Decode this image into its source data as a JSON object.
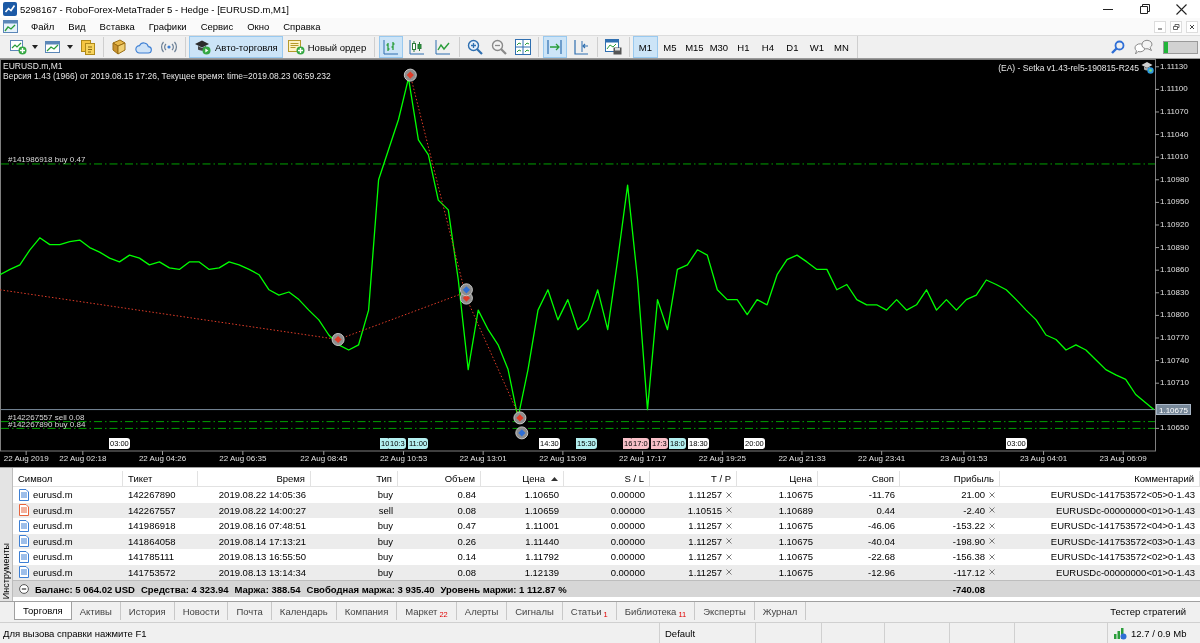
{
  "window": {
    "title": "5298167 - RoboForex-MetaTrader 5 - Hedge - [EURUSD.m,M1]"
  },
  "menu": {
    "items": [
      "Файл",
      "Вид",
      "Вставка",
      "Графики",
      "Сервис",
      "Окно",
      "Справка"
    ]
  },
  "toolbar": {
    "auto_trading": {
      "label": "Авто-торговля",
      "pressed": true
    },
    "new_order": {
      "label": "Новый ордер"
    },
    "chart_types": [
      {
        "selected": true
      },
      {
        "selected": false
      },
      {
        "selected": false
      }
    ],
    "autoscroll": {
      "on": true
    },
    "chart_shift": {
      "on": false
    },
    "timeframes": [
      {
        "label": "M1",
        "selected": true
      },
      {
        "label": "M5",
        "selected": false
      },
      {
        "label": "M15",
        "selected": false
      },
      {
        "label": "M30",
        "selected": false
      },
      {
        "label": "H1",
        "selected": false
      },
      {
        "label": "H4",
        "selected": false
      },
      {
        "label": "D1",
        "selected": false
      },
      {
        "label": "W1",
        "selected": false
      },
      {
        "label": "MN",
        "selected": false
      }
    ]
  },
  "chart": {
    "symbol": "EURUSD.m,M1",
    "info": "Версия 1.43 (1966) от 2019.08.15 17:26, Текущее время: time=2019.08.23 06:59.232",
    "expert": "(EA) - Setka v1.43-rel5-190815-R245",
    "chart_data": [
      {
        "type": "line",
        "x": [
          "2019-08-22T00:05",
          "2019-08-22T00:21",
          "2019-08-22T00:37",
          "2019-08-22T00:53",
          "2019-08-22T01:09",
          "2019-08-22T01:25",
          "2019-08-22T01:41",
          "2019-08-22T01:57",
          "2019-08-22T02:13",
          "2019-08-22T02:29",
          "2019-08-22T02:45",
          "2019-08-22T03:01",
          "2019-08-22T03:17",
          "2019-08-22T03:33",
          "2019-08-22T03:49",
          "2019-08-22T04:05",
          "2019-08-22T04:21",
          "2019-08-22T04:37",
          "2019-08-22T04:53",
          "2019-08-22T05:09",
          "2019-08-22T05:25",
          "2019-08-22T05:41",
          "2019-08-22T05:57",
          "2019-08-22T06:13",
          "2019-08-22T06:29",
          "2019-08-22T06:45",
          "2019-08-22T07:01",
          "2019-08-22T07:17",
          "2019-08-22T07:33",
          "2019-08-22T07:49",
          "2019-08-22T08:05",
          "2019-08-22T08:21",
          "2019-08-22T08:37",
          "2019-08-22T08:53",
          "2019-08-22T09:09",
          "2019-08-22T09:25",
          "2019-08-22T09:41",
          "2019-08-22T09:57",
          "2019-08-22T10:13",
          "2019-08-22T10:29",
          "2019-08-22T10:45",
          "2019-08-22T11:01",
          "2019-08-22T11:17",
          "2019-08-22T11:33",
          "2019-08-22T11:49",
          "2019-08-22T12:05",
          "2019-08-22T12:21",
          "2019-08-22T12:37",
          "2019-08-22T12:53",
          "2019-08-22T13:09",
          "2019-08-22T13:25",
          "2019-08-22T13:41",
          "2019-08-22T13:57",
          "2019-08-22T14:13",
          "2019-08-22T14:29",
          "2019-08-22T14:45",
          "2019-08-22T15:01",
          "2019-08-22T15:17",
          "2019-08-22T15:33",
          "2019-08-22T15:49",
          "2019-08-22T16:05",
          "2019-08-22T16:21",
          "2019-08-22T16:37",
          "2019-08-22T16:53",
          "2019-08-22T17:09",
          "2019-08-22T17:25",
          "2019-08-22T17:41",
          "2019-08-22T17:57",
          "2019-08-22T18:13",
          "2019-08-22T18:29",
          "2019-08-22T18:45",
          "2019-08-22T19:01",
          "2019-08-22T19:17",
          "2019-08-22T19:33",
          "2019-08-22T19:49",
          "2019-08-22T20:05",
          "2019-08-22T20:21",
          "2019-08-22T20:37",
          "2019-08-22T20:53",
          "2019-08-22T21:09",
          "2019-08-22T21:25",
          "2019-08-22T21:41",
          "2019-08-22T21:57",
          "2019-08-22T22:13",
          "2019-08-22T22:29",
          "2019-08-22T22:45",
          "2019-08-22T23:01",
          "2019-08-22T23:17",
          "2019-08-22T23:33",
          "2019-08-22T23:49",
          "2019-08-23T00:05",
          "2019-08-23T00:21",
          "2019-08-23T00:37",
          "2019-08-23T00:53",
          "2019-08-23T01:09",
          "2019-08-23T01:25",
          "2019-08-23T01:41",
          "2019-08-23T01:57",
          "2019-08-23T02:13",
          "2019-08-23T02:29",
          "2019-08-23T02:45",
          "2019-08-23T03:01",
          "2019-08-23T03:17",
          "2019-08-23T03:33",
          "2019-08-23T03:49",
          "2019-08-23T04:05",
          "2019-08-23T04:21",
          "2019-08-23T04:37",
          "2019-08-23T04:53",
          "2019-08-23T05:09",
          "2019-08-23T05:25",
          "2019-08-23T05:41",
          "2019-08-23T05:57",
          "2019-08-23T06:13",
          "2019-08-23T06:29",
          "2019-08-23T06:58"
        ],
        "series": [
          {
            "color": "#00ff00",
            "values": [
              1.10854,
              1.10861,
              1.10867,
              1.10887,
              1.10903,
              1.10894,
              1.10894,
              1.10898,
              1.109,
              1.1089,
              1.10884,
              1.10876,
              1.10871,
              1.1088,
              1.10876,
              1.10867,
              1.10871,
              1.10863,
              1.10861,
              1.10871,
              1.10871,
              1.10861,
              1.10863,
              1.10871,
              1.10867,
              1.10861,
              1.10854,
              1.10834,
              1.10827,
              1.10831,
              1.10821,
              1.10807,
              1.10794,
              1.10774,
              1.10761,
              1.10754,
              1.10761,
              1.10807,
              1.1098,
              1.1102,
              1.1106,
              1.11115,
              1.11033,
              1.11013,
              1.10953,
              1.1094,
              1.10847,
              1.10728,
              1.10807,
              1.10781,
              1.10761,
              1.10728,
              1.10664,
              1.10728,
              1.10807,
              1.10834,
              1.10794,
              1.10821,
              1.10781,
              1.10794,
              1.10834,
              1.10781,
              1.10874,
              1.10973,
              1.10847,
              1.10675,
              1.10821,
              1.10781,
              1.10861,
              1.10867,
              1.10887,
              1.1088,
              1.10834,
              1.10821,
              1.10821,
              1.10801,
              1.10821,
              1.10814,
              1.10854,
              1.10874,
              1.1088,
              1.10871,
              1.10861,
              1.10861,
              1.10834,
              1.10841,
              1.10821,
              1.10814,
              1.10814,
              1.10807,
              1.10821,
              1.10807,
              1.10814,
              1.10834,
              1.10807,
              1.10821,
              1.10807,
              1.10821,
              1.10827,
              1.10847,
              1.10841,
              1.10834,
              1.10821,
              1.10807,
              1.10794,
              1.10774,
              1.10768,
              1.10754,
              1.10761,
              1.10754,
              1.10741,
              1.10728,
              1.10721,
              1.10715,
              1.10695,
              1.10675
            ]
          },
          {
            "type": "line",
            "line_style": "dotted",
            "color": "#e03c28",
            "x": [
              "2019-08-22T00:05",
              "2019-08-22T09:08",
              "2019-08-22T12:34"
            ],
            "values": [
              1.10834,
              1.10768,
              1.10831
            ]
          },
          {
            "type": "line",
            "line_style": "dotted",
            "marker": "diamond",
            "color": "#e03c28",
            "x": [
              "2019-08-22T11:04",
              "2019-08-22T12:34",
              "2019-08-22T14:00"
            ],
            "values": [
              1.11119,
              1.10823,
              1.10664
            ]
          },
          {
            "type": "scatter",
            "marker": "diamond",
            "color": "#e03c28",
            "x": [
              "2019-08-22T09:08"
            ],
            "values": [
              1.10768
            ]
          },
          {
            "type": "scatter",
            "marker": "diamond",
            "color": "#2f6fd6",
            "x": [
              "2019-08-22T12:34",
              "2019-08-22T14:03"
            ],
            "values": [
              1.10834,
              1.10644
            ]
          }
        ],
        "xlim": [
          "2019-08-22T00:05",
          "2019-08-23T07:00"
        ],
        "ylim": [
          1.1062,
          1.11139
        ],
        "xticks": [
          {
            "value": "2019-08-22T00:47",
            "label": "22 Aug 2019"
          },
          {
            "value": "2019-08-22T02:18",
            "label": "22 Aug 02:18"
          },
          {
            "value": "2019-08-22T04:26",
            "label": "22 Aug 04:26"
          },
          {
            "value": "2019-08-22T06:35",
            "label": "22 Aug 06:35"
          },
          {
            "value": "2019-08-22T08:45",
            "label": "22 Aug 08:45"
          },
          {
            "value": "2019-08-22T10:53",
            "label": "22 Aug 10:53"
          },
          {
            "value": "2019-08-22T13:01",
            "label": "22 Aug 13:01"
          },
          {
            "value": "2019-08-22T15:09",
            "label": "22 Aug 15:09"
          },
          {
            "value": "2019-08-22T17:17",
            "label": "22 Aug 17:17"
          },
          {
            "value": "2019-08-22T19:25",
            "label": "22 Aug 19:25"
          },
          {
            "value": "2019-08-22T21:33",
            "label": "22 Aug 21:33"
          },
          {
            "value": "2019-08-22T23:41",
            "label": "22 Aug 23:41"
          },
          {
            "value": "2019-08-23T01:53",
            "label": "23 Aug 01:53"
          },
          {
            "value": "2019-08-23T04:01",
            "label": "23 Aug 04:01"
          },
          {
            "value": "2019-08-23T06:09",
            "label": "23 Aug 06:09"
          }
        ],
        "yticks": [
          {
            "value": 1.1113,
            "label": "1.11130"
          },
          {
            "value": 1.111,
            "label": "1.11100"
          },
          {
            "value": 1.1107,
            "label": "1.11070"
          },
          {
            "value": 1.1104,
            "label": "1.11040"
          },
          {
            "value": 1.1101,
            "label": "1.11010"
          },
          {
            "value": 1.1098,
            "label": "1.10980"
          },
          {
            "value": 1.1095,
            "label": "1.10950"
          },
          {
            "value": 1.1092,
            "label": "1.10920"
          },
          {
            "value": 1.1089,
            "label": "1.10890"
          },
          {
            "value": 1.1086,
            "label": "1.10860"
          },
          {
            "value": 1.1083,
            "label": "1.10830"
          },
          {
            "value": 1.108,
            "label": "1.10800"
          },
          {
            "value": 1.1077,
            "label": "1.10770"
          },
          {
            "value": 1.1074,
            "label": "1.10740"
          },
          {
            "value": 1.1071,
            "label": "1.10710"
          },
          {
            "value": 1.1065,
            "label": "1.10650"
          }
        ],
        "ref_lines": [
          {
            "axis": "y",
            "value": 1.11001,
            "label": "#141986918 buy 0.47",
            "color": "#00a000",
            "line_style": "dashdot"
          },
          {
            "axis": "y",
            "value": 1.10675,
            "label": "1.10675",
            "color": "#778899",
            "line_style": "solid"
          },
          {
            "axis": "y",
            "value": 1.10659,
            "label": "#142267557 sell 0.08",
            "color": "#00a000",
            "line_style": "dashdot"
          },
          {
            "axis": "y",
            "value": 1.1065,
            "label": "#142267890 buy 0.84",
            "color": "#00a000",
            "line_style": "dashdot"
          }
        ]
      }
    ],
    "events": [
      {
        "label": "03:00",
        "color": "#ffffff"
      },
      {
        "label": "10",
        "color": "#b4f0f0"
      },
      {
        "label": "10:3",
        "color": "#b4f0f0"
      },
      {
        "label": "11:00",
        "color": "#b4f0f0"
      },
      {
        "label": "14:30",
        "color": "#ffffff"
      },
      {
        "label": "15:30",
        "color": "#b4f0f0"
      },
      {
        "label": "16",
        "color": "#f8c0c8"
      },
      {
        "label": "17:0",
        "color": "#f8c0c8"
      },
      {
        "label": "17:3",
        "color": "#f8c0c8"
      },
      {
        "label": "18:0",
        "color": "#b4f0f0"
      },
      {
        "label": "18:30",
        "color": "#ffffff"
      },
      {
        "label": "20:00",
        "color": "#ffffff"
      },
      {
        "label": "03:00",
        "color": "#ffffff"
      }
    ]
  },
  "trade_panel": {
    "side_tab": "Инструменты",
    "columns": [
      {
        "label": "Символ",
        "sorted": false
      },
      {
        "label": "Тикет",
        "sorted": false
      },
      {
        "label": "Время",
        "sorted": false
      },
      {
        "label": "Тип",
        "sorted": false
      },
      {
        "label": "Объем",
        "sorted": false
      },
      {
        "label": "Цена",
        "sorted": true
      },
      {
        "label": "S / L",
        "sorted": false
      },
      {
        "label": "T / P",
        "sorted": false
      },
      {
        "label": "Цена",
        "sorted": false
      },
      {
        "label": "Своп",
        "sorted": false
      },
      {
        "label": "Прибыль",
        "sorted": false
      },
      {
        "label": "Комментарий",
        "sorted": false
      }
    ],
    "rows": [
      {
        "color": "#3d7fd4",
        "cells": [
          "eurusd.m",
          "142267890",
          "2019.08.22 14:05:36",
          "buy",
          "0.84",
          "1.10650",
          "0.00000",
          "1.11257",
          "1.10675",
          "-11.76",
          "21.00",
          "EURUSDc-141753572<05>0-1.43"
        ]
      },
      {
        "color": "#e8643c",
        "cells": [
          "eurusd.m",
          "142267557",
          "2019.08.22 14:00:27",
          "sell",
          "0.08",
          "1.10659",
          "0.00000",
          "1.10515",
          "1.10689",
          "0.44",
          "-2.40",
          "EURUSDc-00000000<01>0-1.43"
        ]
      },
      {
        "color": "#3d7fd4",
        "cells": [
          "eurusd.m",
          "141986918",
          "2019.08.16 07:48:51",
          "buy",
          "0.47",
          "1.11001",
          "0.00000",
          "1.11257",
          "1.10675",
          "-46.06",
          "-153.22",
          "EURUSDc-141753572<04>0-1.43"
        ]
      },
      {
        "color": "#3d7fd4",
        "cells": [
          "eurusd.m",
          "141864058",
          "2019.08.14 17:13:21",
          "buy",
          "0.26",
          "1.11440",
          "0.00000",
          "1.11257",
          "1.10675",
          "-40.04",
          "-198.90",
          "EURUSDc-141753572<03>0-1.43"
        ]
      },
      {
        "color": "#3d7fd4",
        "cells": [
          "eurusd.m",
          "141785111",
          "2019.08.13 16:55:50",
          "buy",
          "0.14",
          "1.11792",
          "0.00000",
          "1.11257",
          "1.10675",
          "-22.68",
          "-156.38",
          "EURUSDc-141753572<02>0-1.43"
        ]
      },
      {
        "color": "#3d7fd4",
        "cells": [
          "eurusd.m",
          "141753572",
          "2019.08.13 13:14:34",
          "buy",
          "0.08",
          "1.12139",
          "0.00000",
          "1.11257",
          "1.10675",
          "-12.96",
          "-117.12",
          "EURUSDc-00000000<01>0-1.43"
        ]
      }
    ],
    "summary": {
      "expanded": true,
      "items": [
        "Баланс: 5 064.02 USD",
        "Средства: 4 323.94",
        "Маржа: 388.54",
        "Свободная маржа: 3 935.40",
        "Уровень маржи: 1 112.87 %"
      ],
      "profit": "-740.08"
    }
  },
  "bottom_tabs": {
    "tabs": [
      {
        "label": "Торговля",
        "selected": true
      },
      {
        "label": "Активы",
        "selected": false
      },
      {
        "label": "История",
        "selected": false
      },
      {
        "label": "Новости",
        "selected": false
      },
      {
        "label": "Почта",
        "selected": false
      },
      {
        "label": "Календарь",
        "selected": false
      },
      {
        "label": "Компания",
        "selected": false
      },
      {
        "label": "Маркет",
        "count": "22",
        "selected": false
      },
      {
        "label": "Алерты",
        "selected": false
      },
      {
        "label": "Сигналы",
        "selected": false
      },
      {
        "label": "Статьи",
        "count": "1",
        "selected": false
      },
      {
        "label": "Библиотека",
        "count": "11",
        "selected": false
      },
      {
        "label": "Эксперты",
        "selected": false
      },
      {
        "label": "Журнал",
        "selected": false
      }
    ],
    "tester": "Тестер стратегий"
  },
  "status_bar": {
    "help": "Для вызова справки нажмите F1",
    "profile": "Default",
    "traffic": "12.7 / 0.9 Mb"
  }
}
